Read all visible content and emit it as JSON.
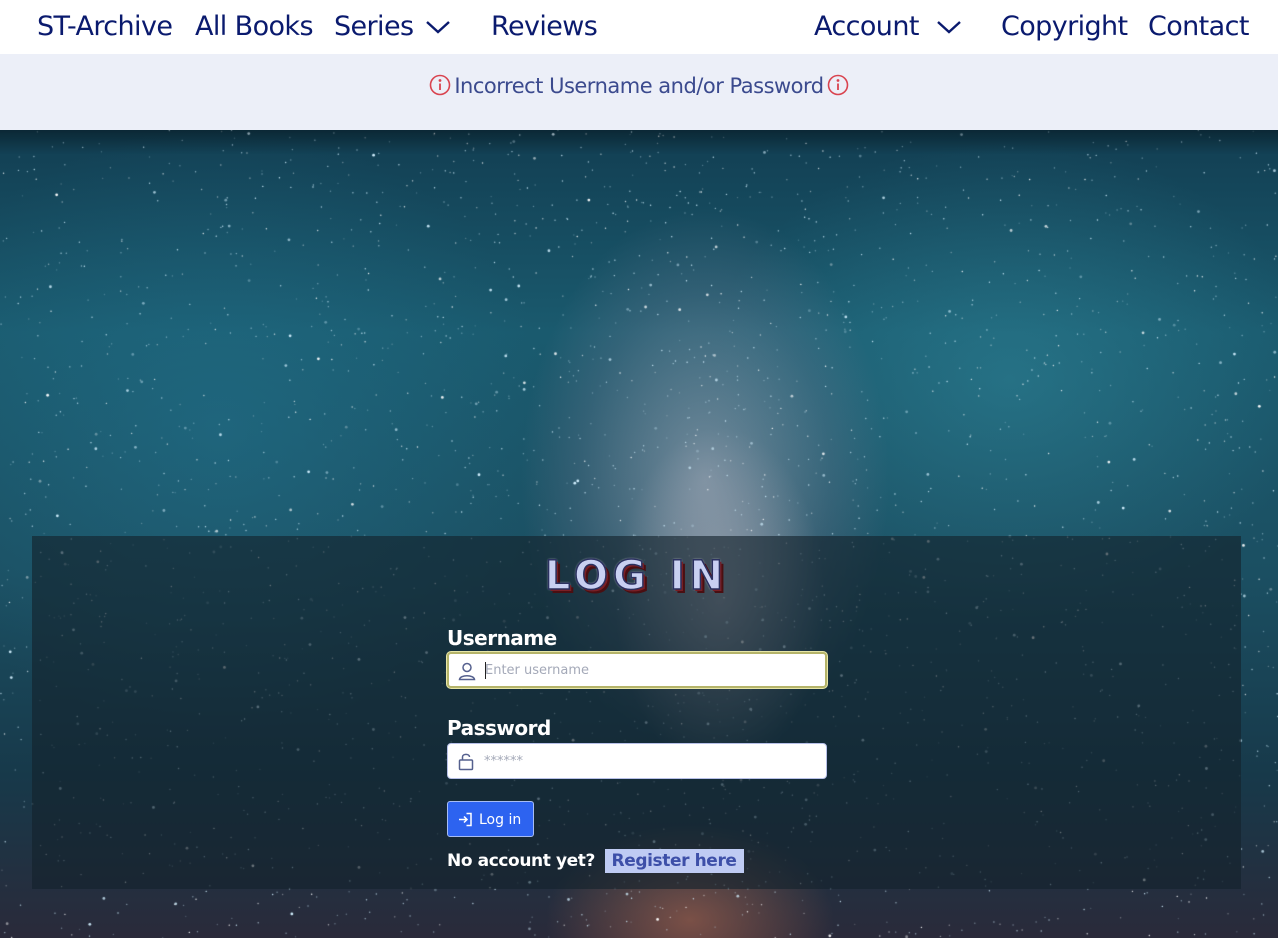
{
  "nav": {
    "brand": "ST-Archive",
    "all_books": "All Books",
    "series": "Series",
    "reviews": "Reviews",
    "account": "Account",
    "copyright": "Copyright",
    "contact": "Contact"
  },
  "alert": {
    "message": "Incorrect Username and/or Password"
  },
  "login": {
    "title": "LOG IN",
    "username_label": "Username",
    "username_placeholder": "Enter username",
    "username_value": "",
    "password_label": "Password",
    "password_placeholder": "******",
    "password_value": "",
    "submit_label": "Log in",
    "no_account_text": "No account yet?",
    "register_link": "Register here"
  },
  "colors": {
    "nav_text": "#0a1a6e",
    "alert_bg": "#eceff8",
    "alert_icon": "#d9434f",
    "button_bg": "#2d63f0",
    "register_bg": "#bfcbf3"
  },
  "icons": {
    "series_dropdown": "chevron-down-icon",
    "account_dropdown": "chevron-down-icon",
    "alert": "info-icon",
    "username": "user-icon",
    "password": "lock-icon",
    "submit": "login-arrow-icon"
  }
}
